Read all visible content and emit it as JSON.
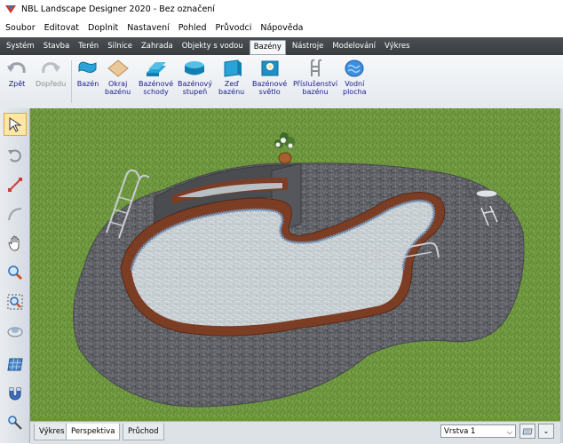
{
  "window": {
    "title": "NBL Landscape Designer 2020 - Bez označení"
  },
  "menu": [
    "Soubor",
    "Editovat",
    "Doplnit",
    "Nastavení",
    "Pohled",
    "Průvodci",
    "Nápověda"
  ],
  "tabs": [
    "Systém",
    "Stavba",
    "Terén",
    "Silnice",
    "Zahrada",
    "Objekty s vodou",
    "Bazény",
    "Nástroje",
    "Modelování",
    "Výkres"
  ],
  "active_tab": "Bazény",
  "ribbon": {
    "zpet": "Zpět",
    "dopredu": "Dopředu",
    "bazen": "Bazén",
    "okraj_1": "Okraj",
    "okraj_2": "bazénu",
    "schody_1": "Bazénové",
    "schody_2": "schody",
    "stupen_1": "Bazénový",
    "stupen_2": "stupeň",
    "zed_1": "Zeď",
    "zed_2": "bazénu",
    "svetlo_1": "Bazénové",
    "svetlo_2": "světlo",
    "prisl_1": "Příslušenství",
    "prisl_2": "bazénu",
    "vodni_1": "Vodní",
    "vodni_2": "plocha"
  },
  "bottom_tabs": [
    "Výkres",
    "Perspektiva",
    "Průchod"
  ],
  "active_bottom_tab": "Perspektiva",
  "layer": {
    "value": "Vrstva 1"
  },
  "colors": {
    "tabbar": "#434649",
    "grass": "#6f9840",
    "paving": "#5c5e63",
    "coping": "#7c3d25",
    "water": "#c9d0d3"
  }
}
